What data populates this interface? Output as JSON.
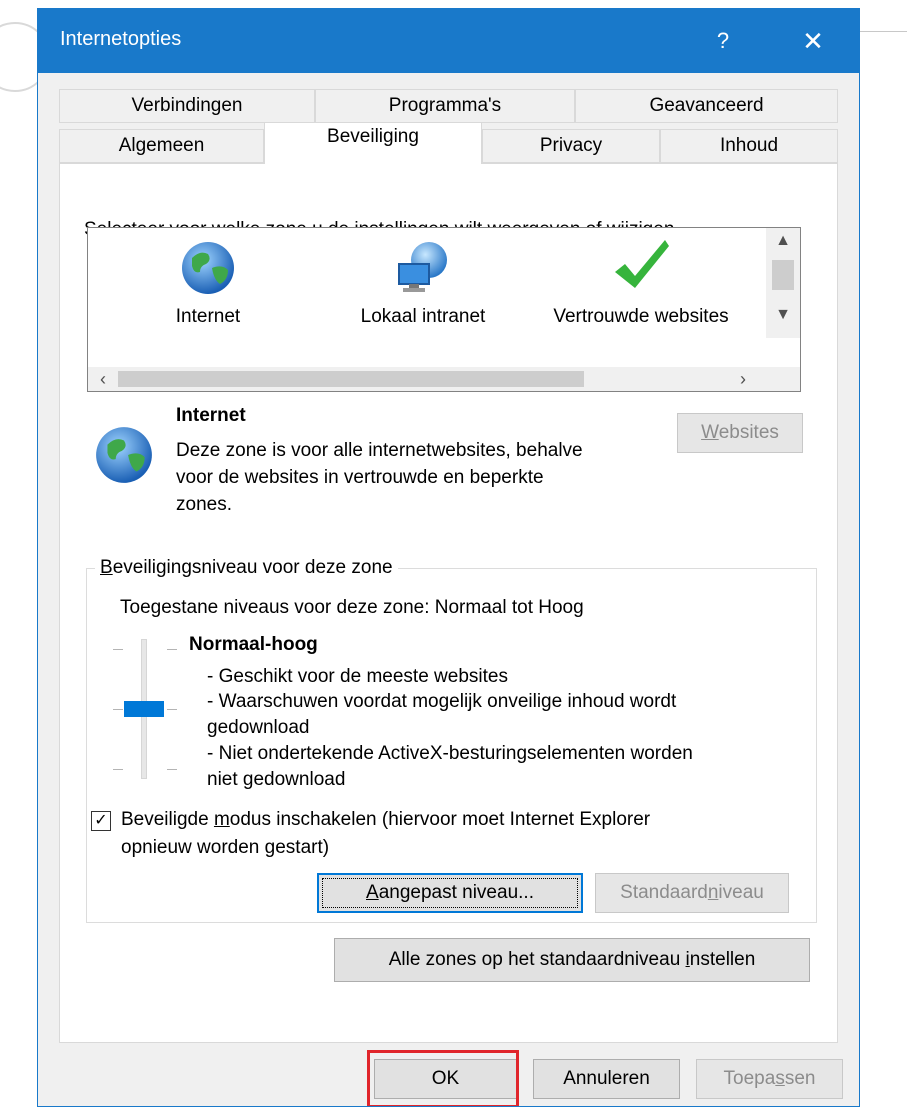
{
  "window": {
    "title": "Internetopties",
    "help_label": "?",
    "close_label": "✕"
  },
  "tabs": {
    "row_back": [
      "Verbindingen",
      "Programma's",
      "Geavanceerd"
    ],
    "row_front": [
      "Algemeen",
      "Beveiliging",
      "Privacy",
      "Inhoud"
    ],
    "active": "Beveiliging"
  },
  "zones": {
    "instruction": "Selecteer voor welke zone u de instellingen wilt weergeven of wijzigen.",
    "items": [
      {
        "label": "Internet",
        "icon": "globe-icon"
      },
      {
        "label": "Lokaal intranet",
        "icon": "intranet-icon"
      },
      {
        "label": "Vertrouwde websites",
        "icon": "checkmark-icon"
      }
    ]
  },
  "zone_detail": {
    "title": "Internet",
    "description_lines": [
      "Deze zone is voor alle internetwebsites, behalve",
      "voor de websites in vertrouwde en beperkte",
      "zones."
    ],
    "websites_button": {
      "prefix": "",
      "accel": "W",
      "suffix": "ebsites"
    }
  },
  "security": {
    "group_label": {
      "accel": "B",
      "suffix": "eveiligingsniveau voor deze zone"
    },
    "allowed_levels": "Toegestane niveaus voor deze zone: Normaal tot Hoog",
    "level_name": "Normaal-hoog",
    "level_lines": [
      "- Geschikt voor de meeste websites",
      "- Waarschuwen voordat mogelijk onveilige inhoud wordt",
      "gedownload",
      "- Niet ondertekende ActiveX-besturingselementen worden",
      "niet gedownload"
    ],
    "protected_mode_checked": true,
    "protected_mode_line1": {
      "prefix": "Beveiligde ",
      "accel": "m",
      "suffix": "odus inschakelen (hiervoor moet Internet Explorer"
    },
    "protected_mode_line2": "opnieuw worden gestart)",
    "custom_level_button": {
      "accel": "A",
      "suffix": "angepast niveau..."
    },
    "default_level_button": {
      "prefix": "Standaard",
      "accel": "n",
      "suffix": "iveau"
    },
    "reset_all_button": {
      "prefix": "Alle zones op het standaardniveau ",
      "accel": "i",
      "suffix": "nstellen"
    }
  },
  "footer": {
    "ok_label": "OK",
    "cancel_label": "Annuleren",
    "apply_button": {
      "prefix": "Toepa",
      "accel": "s",
      "suffix": "sen"
    },
    "highlight_color": "#e0252b"
  },
  "colors": {
    "titlebar": "#1979ca",
    "slider_thumb": "#0078d7"
  }
}
